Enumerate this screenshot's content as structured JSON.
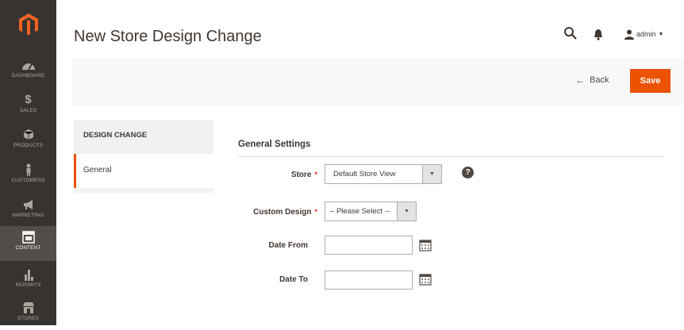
{
  "sidebar": {
    "items": [
      {
        "label": "DASHBOARD",
        "icon": "dashboard-icon"
      },
      {
        "label": "SALES",
        "icon": "dollar-icon"
      },
      {
        "label": "PRODUCTS",
        "icon": "cube-icon"
      },
      {
        "label": "CUSTOMERS",
        "icon": "person-icon"
      },
      {
        "label": "MARKETING",
        "icon": "megaphone-icon"
      },
      {
        "label": "CONTENT",
        "icon": "layout-icon",
        "active": true
      },
      {
        "label": "REPORTS",
        "icon": "bar-chart-icon"
      },
      {
        "label": "STORES",
        "icon": "storefront-icon"
      }
    ]
  },
  "header": {
    "title": "New Store Design Change",
    "user": "admin"
  },
  "actions": {
    "back_label": "Back",
    "save_label": "Save"
  },
  "tabs": {
    "title": "DESIGN CHANGE",
    "items": [
      {
        "label": "General"
      }
    ]
  },
  "form": {
    "section_title": "General Settings",
    "store_label": "Store",
    "store_value": "Default Store View",
    "custom_design_label": "Custom Design",
    "custom_design_value": "-- Please Select --",
    "date_from_label": "Date From",
    "date_from_value": "",
    "date_to_label": "Date To",
    "date_to_value": ""
  },
  "colors": {
    "accent": "#eb5202",
    "sidebar_bg": "#373330",
    "required": "#e22626"
  }
}
